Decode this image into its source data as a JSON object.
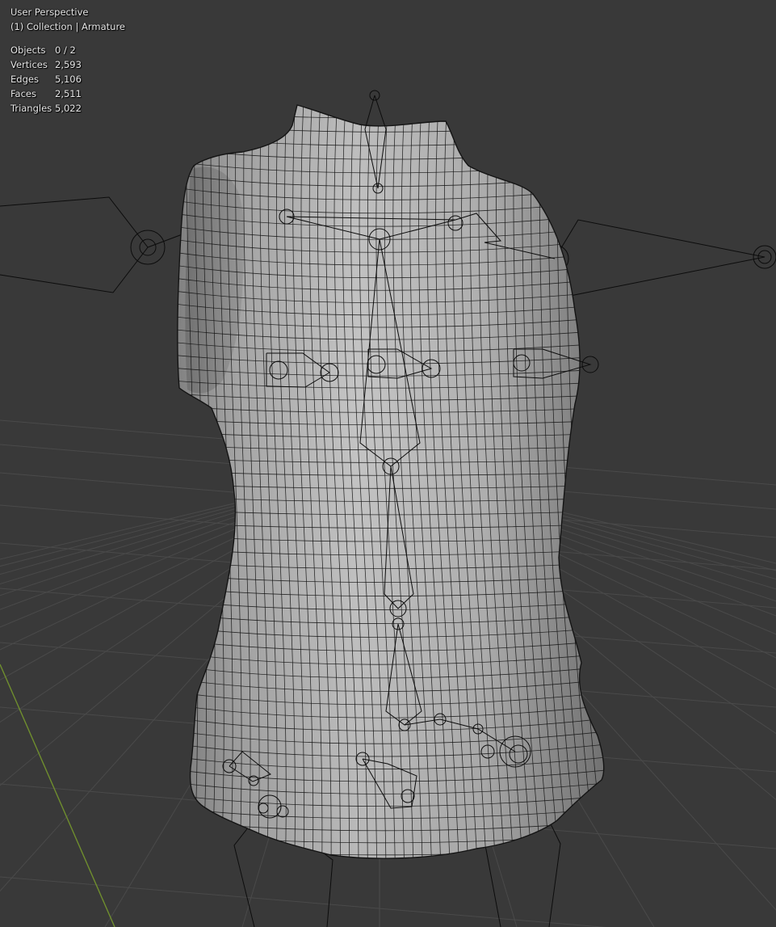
{
  "viewport": {
    "view_name": "User Perspective",
    "collection_info": "(1) Collection | Armature",
    "stats": [
      {
        "label": "Objects",
        "value": "0 / 2"
      },
      {
        "label": "Vertices",
        "value": "2,593"
      },
      {
        "label": "Edges",
        "value": "5,106"
      },
      {
        "label": "Faces",
        "value": "2,511"
      },
      {
        "label": "Triangles",
        "value": "5,022"
      }
    ],
    "colors": {
      "background": "#393939",
      "grid": "#4a4a4a",
      "y_axis": "#6f8e2e",
      "mesh_fill": "#a9a9a9",
      "wire": "#141414",
      "bone_line": "#0c0c0c"
    },
    "mesh": {
      "name": "sleeveless-top",
      "bones": [
        "neck",
        "spine-upper",
        "spine-mid",
        "spine-lower",
        "hips",
        "shoulder-left",
        "shoulder-right",
        "breast-left",
        "breast-right",
        "upper-arm-left",
        "upper-arm-right",
        "thigh-left",
        "thigh-right"
      ]
    }
  }
}
